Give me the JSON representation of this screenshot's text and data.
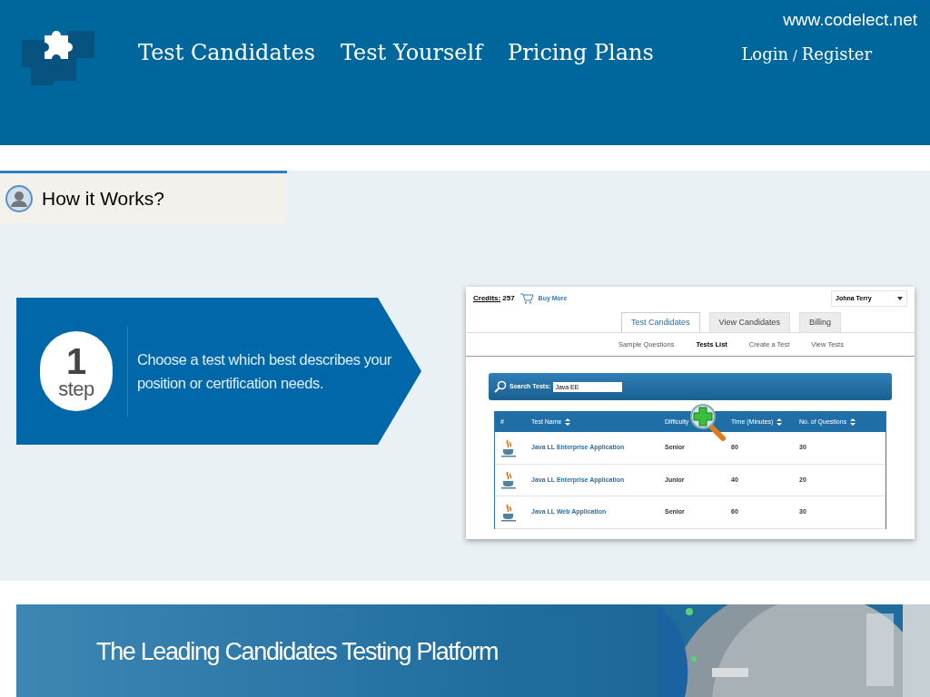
{
  "header": {
    "site_url": "www.codelect.net",
    "nav": [
      "Test Candidates",
      "Test Yourself",
      "Pricing Plans"
    ],
    "login": "Login",
    "separator": "/",
    "register": "Register"
  },
  "how_it_works": {
    "title": "How it Works?"
  },
  "step": {
    "number": "1",
    "label": "step",
    "text": "Choose a test which best describes your position or certification needs."
  },
  "app": {
    "credits_label": "Credits:",
    "credits": "257",
    "buy_more": "Buy More",
    "user": "Johna Terry",
    "tabs": [
      {
        "label": "Test Candidates",
        "selected": true
      },
      {
        "label": "View Candidates",
        "selected": false
      },
      {
        "label": "Billing",
        "selected": false
      }
    ],
    "subtabs": [
      {
        "label": "Sample Questions",
        "selected": false
      },
      {
        "label": "Tests List",
        "selected": true
      },
      {
        "label": "Create a Test",
        "selected": false
      },
      {
        "label": "View Tests",
        "selected": false
      }
    ],
    "search": {
      "label": "Search Tests:",
      "value": "Java EE"
    },
    "table": {
      "columns": [
        "#",
        "Test Name",
        "Difficulty",
        "Time (Minutes)",
        "No. of Questions"
      ],
      "rows": [
        {
          "name": "Java LL Enterprise Application",
          "difficulty": "Senior",
          "time": "60",
          "questions": "30"
        },
        {
          "name": "Java LL Enterprise Application",
          "difficulty": "Junior",
          "time": "40",
          "questions": "20"
        },
        {
          "name": "Java LL Web Application",
          "difficulty": "Senior",
          "time": "60",
          "questions": "30"
        }
      ]
    }
  },
  "banner": {
    "title": "The Leading Candidates Testing Platform"
  }
}
